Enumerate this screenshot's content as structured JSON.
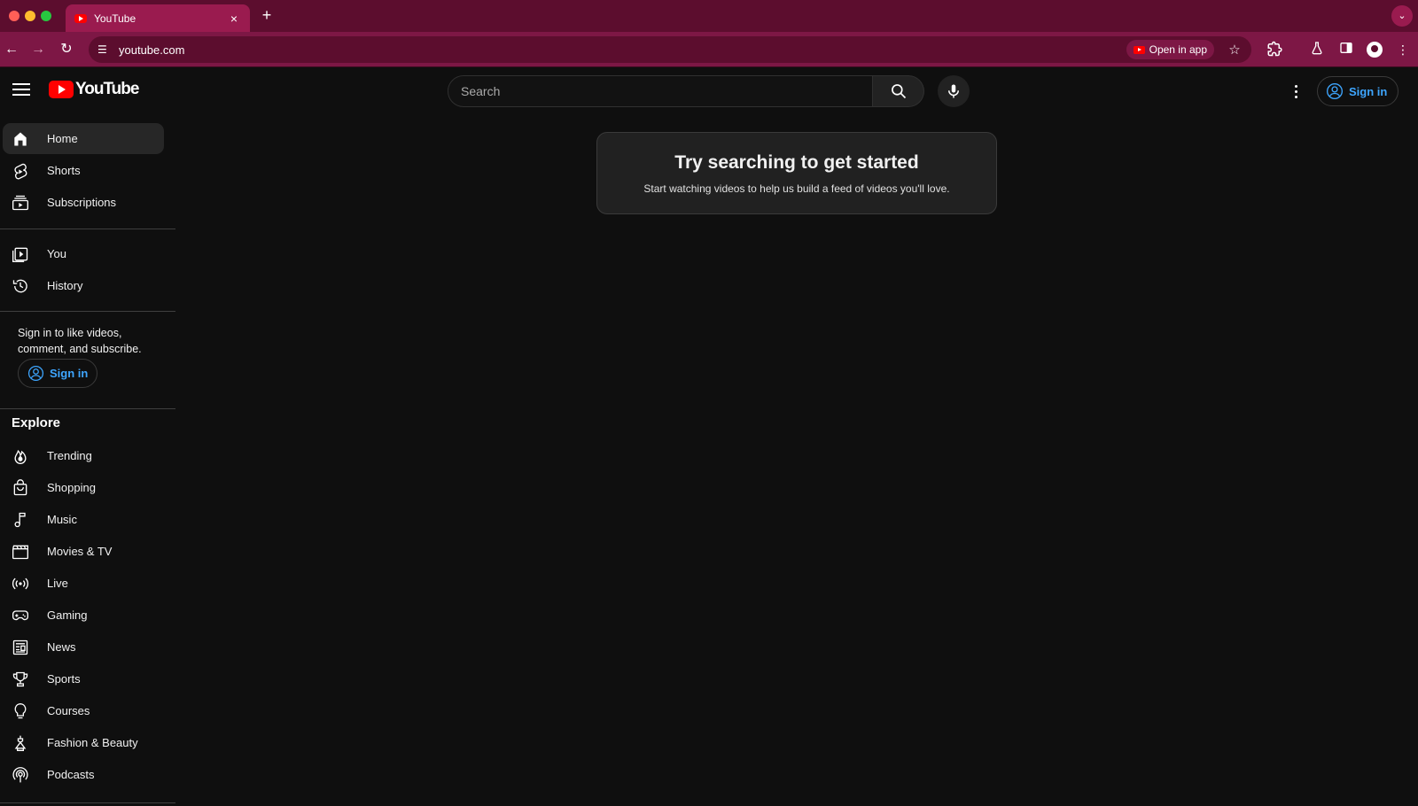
{
  "browser": {
    "tab_title": "YouTube",
    "tab_close": "×",
    "new_tab": "+",
    "url": "youtube.com",
    "open_in_app": "Open in app"
  },
  "header": {
    "logo_text": "YouTube",
    "search_placeholder": "Search",
    "sign_in": "Sign in"
  },
  "sidebar": {
    "primary": [
      {
        "label": "Home",
        "icon": "home-icon",
        "active": true
      },
      {
        "label": "Shorts",
        "icon": "shorts-icon"
      },
      {
        "label": "Subscriptions",
        "icon": "subscriptions-icon"
      }
    ],
    "you": [
      {
        "label": "You",
        "icon": "you-icon"
      },
      {
        "label": "History",
        "icon": "history-icon"
      }
    ],
    "signin_prompt": "Sign in to like videos, comment, and subscribe.",
    "signin_button": "Sign in",
    "explore_title": "Explore",
    "explore": [
      {
        "label": "Trending",
        "icon": "trending-icon"
      },
      {
        "label": "Shopping",
        "icon": "shopping-icon"
      },
      {
        "label": "Music",
        "icon": "music-icon"
      },
      {
        "label": "Movies & TV",
        "icon": "movies-icon"
      },
      {
        "label": "Live",
        "icon": "live-icon"
      },
      {
        "label": "Gaming",
        "icon": "gaming-icon"
      },
      {
        "label": "News",
        "icon": "news-icon"
      },
      {
        "label": "Sports",
        "icon": "sports-icon"
      },
      {
        "label": "Courses",
        "icon": "courses-icon"
      },
      {
        "label": "Fashion & Beauty",
        "icon": "fashion-icon"
      },
      {
        "label": "Podcasts",
        "icon": "podcasts-icon"
      }
    ]
  },
  "main": {
    "empty_title": "Try searching to get started",
    "empty_subtitle": "Start watching videos to help us build a feed of videos you'll love."
  },
  "colors": {
    "tab_strip": "#5c0d2e",
    "toolbar": "#7d1745",
    "background": "#0f0f0f",
    "link_blue": "#3ea6ff",
    "brand_red": "#ff0000"
  }
}
